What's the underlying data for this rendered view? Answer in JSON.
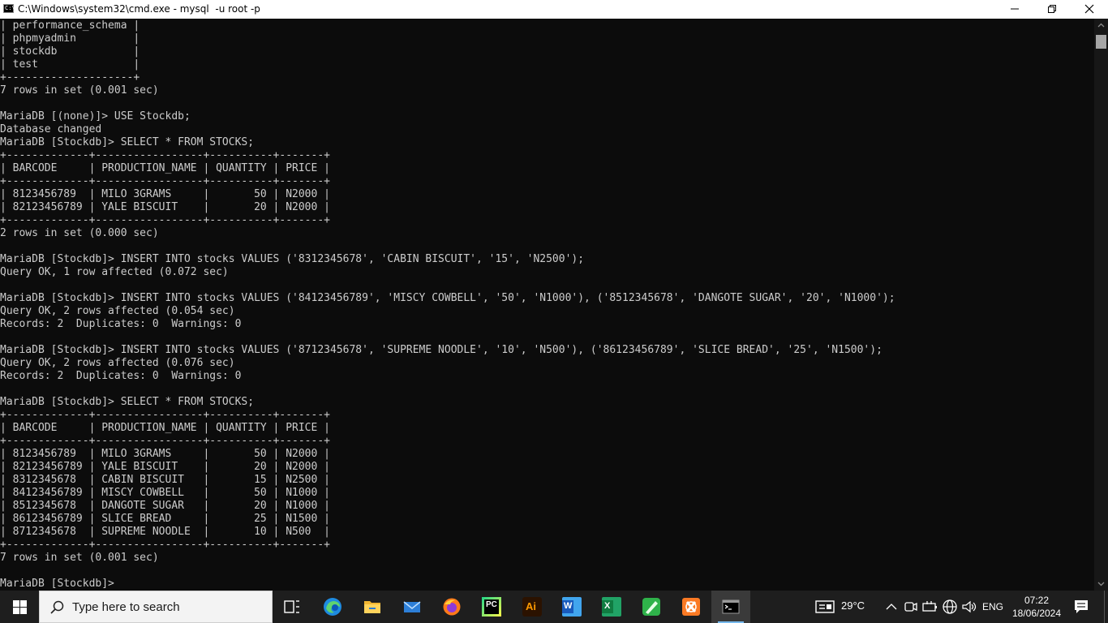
{
  "window": {
    "title": "C:\\Windows\\system32\\cmd.exe - mysql  -u root -p",
    "minimize": "minimize",
    "maximize": "maximize",
    "close": "close"
  },
  "console": {
    "text": "| performance_schema |\n| phpmyadmin         |\n| stockdb            |\n| test               |\n+--------------------+\n7 rows in set (0.001 sec)\n\nMariaDB [(none)]> USE Stockdb;\nDatabase changed\nMariaDB [Stockdb]> SELECT * FROM STOCKS;\n+-------------+-----------------+----------+-------+\n| BARCODE     | PRODUCTION_NAME | QUANTITY | PRICE |\n+-------------+-----------------+----------+-------+\n| 8123456789  | MILO 3GRAMS     |       50 | N2000 |\n| 82123456789 | YALE BISCUIT    |       20 | N2000 |\n+-------------+-----------------+----------+-------+\n2 rows in set (0.000 sec)\n\nMariaDB [Stockdb]> INSERT INTO stocks VALUES ('8312345678', 'CABIN BISCUIT', '15', 'N2500');\nQuery OK, 1 row affected (0.072 sec)\n\nMariaDB [Stockdb]> INSERT INTO stocks VALUES ('84123456789', 'MISCY COWBELL', '50', 'N1000'), ('8512345678', 'DANGOTE SUGAR', '20', 'N1000');\nQuery OK, 2 rows affected (0.054 sec)\nRecords: 2  Duplicates: 0  Warnings: 0\n\nMariaDB [Stockdb]> INSERT INTO stocks VALUES ('8712345678', 'SUPREME NOODLE', '10', 'N500'), ('86123456789', 'SLICE BREAD', '25', 'N1500');\nQuery OK, 2 rows affected (0.076 sec)\nRecords: 2  Duplicates: 0  Warnings: 0\n\nMariaDB [Stockdb]> SELECT * FROM STOCKS;\n+-------------+-----------------+----------+-------+\n| BARCODE     | PRODUCTION_NAME | QUANTITY | PRICE |\n+-------------+-----------------+----------+-------+\n| 8123456789  | MILO 3GRAMS     |       50 | N2000 |\n| 82123456789 | YALE BISCUIT    |       20 | N2000 |\n| 8312345678  | CABIN BISCUIT   |       15 | N2500 |\n| 84123456789 | MISCY COWBELL   |       50 | N1000 |\n| 8512345678  | DANGOTE SUGAR   |       20 | N1000 |\n| 86123456789 | SLICE BREAD     |       25 | N1500 |\n| 8712345678  | SUPREME NOODLE  |       10 | N500  |\n+-------------+-----------------+----------+-------+\n7 rows in set (0.001 sec)\n\nMariaDB [Stockdb]> ",
    "foreground": "#cccccc",
    "background": "#0c0c0c"
  },
  "taskbar": {
    "search_placeholder": "Type here to search",
    "apps": [
      {
        "icon": "task-view-icon"
      },
      {
        "icon": "edge-icon"
      },
      {
        "icon": "file-explorer-icon"
      },
      {
        "icon": "mail-icon"
      },
      {
        "icon": "firefox-icon"
      },
      {
        "icon": "pycharm-icon",
        "text": "PC"
      },
      {
        "icon": "illustrator-icon",
        "text": "Ai"
      },
      {
        "icon": "word-icon",
        "text": "W"
      },
      {
        "icon": "excel-icon",
        "text": "X"
      },
      {
        "icon": "notepad-pen-icon"
      },
      {
        "icon": "xampp-icon"
      },
      {
        "icon": "cmd-icon",
        "active": true
      }
    ],
    "weather": "29°C",
    "language": "ENG",
    "time": "07:22",
    "date": "18/06/2024"
  }
}
